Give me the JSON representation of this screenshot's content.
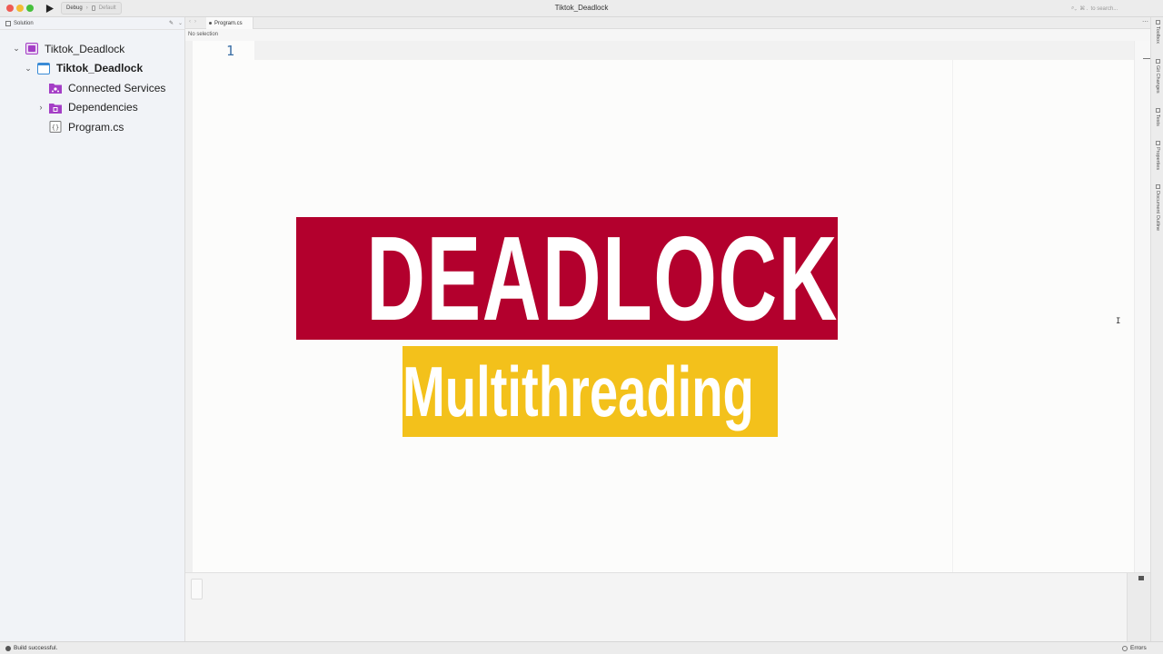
{
  "window": {
    "title": "Tiktok_Deadlock"
  },
  "toolbar": {
    "config": "Debug",
    "target": "Default",
    "search_placeholder": "to search..."
  },
  "solution_panel": {
    "title": "Solution",
    "items": [
      {
        "label": "Tiktok_Deadlock",
        "icon": "solution-icon",
        "expanded": true
      },
      {
        "label": "Tiktok_Deadlock",
        "icon": "project-icon",
        "expanded": true
      },
      {
        "label": "Connected Services",
        "icon": "connected-services-folder-icon"
      },
      {
        "label": "Dependencies",
        "icon": "dependencies-folder-icon",
        "expanded": false
      },
      {
        "label": "Program.cs",
        "icon": "csharp-file-icon"
      }
    ]
  },
  "editor": {
    "tab": "Program.cs",
    "path": "No selection",
    "line_numbers": [
      "1"
    ]
  },
  "banner": {
    "title": "DEADLOCK",
    "subtitle": "Multithreading"
  },
  "right_dock": {
    "items": [
      "Toolbox",
      "Git Changes",
      "Tests",
      "Properties",
      "Document Outline"
    ]
  },
  "status": {
    "message": "Build successful.",
    "errors_label": "Errors"
  },
  "colors": {
    "banner_red": "#b3002d",
    "banner_yellow": "#f3c11b",
    "line_number": "#3a6ea5",
    "solution_icon_purple": "#a43ec6"
  }
}
